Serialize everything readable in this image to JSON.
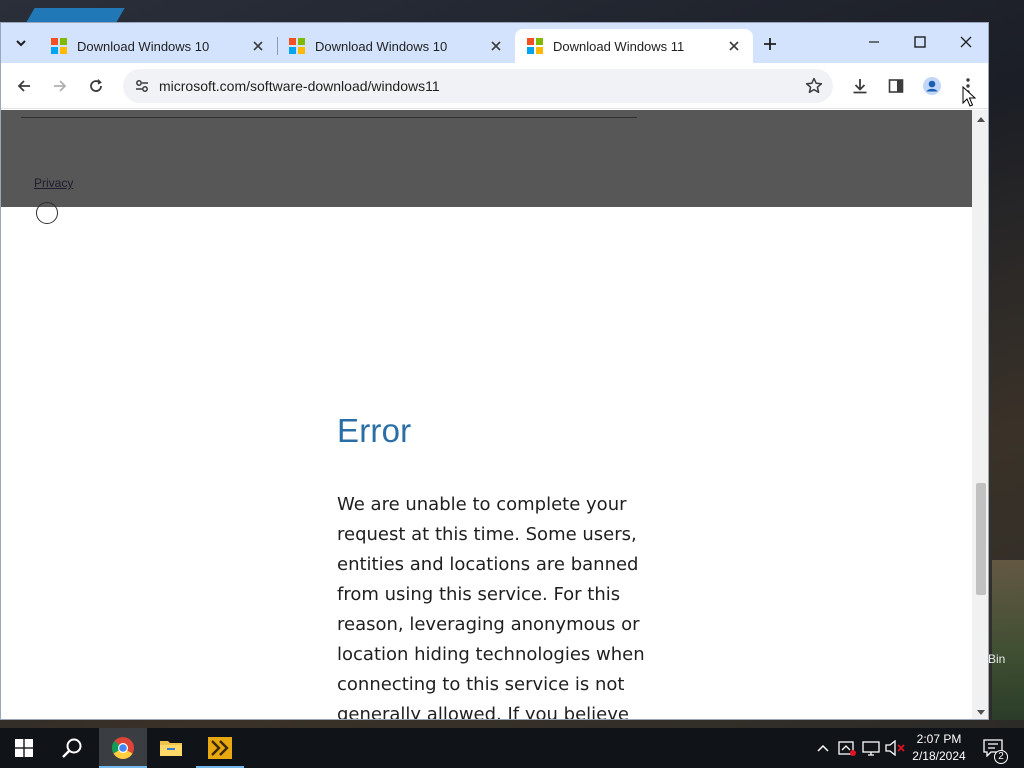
{
  "browser": {
    "tabs": [
      {
        "title": "Download Windows 10",
        "active": false
      },
      {
        "title": "Download Windows 10",
        "active": false
      },
      {
        "title": "Download Windows 11",
        "active": true
      }
    ],
    "url": "microsoft.com/software-download/windows11"
  },
  "page": {
    "footer_link": "Privacy",
    "error_title": "Error",
    "error_message": "We are unable to complete your request at this time. Some users, entities and locations are banned from using this service. For this reason, leveraging anonymous or location hiding technologies when connecting to this service is not generally allowed. If you believe that you encountered this"
  },
  "desktop": {
    "recycle_bin_label": "Bin"
  },
  "taskbar": {
    "time": "2:07 PM",
    "date": "2/18/2024",
    "notification_count": "2"
  },
  "colors": {
    "tabstrip": "#d3e3fd",
    "error_title": "#2a6ea6",
    "footer_bg": "#575757",
    "taskbar": "#101317",
    "ms_red": "#f25022",
    "ms_green": "#7fba00",
    "ms_blue": "#00a4ef",
    "ms_yellow": "#ffb900"
  }
}
